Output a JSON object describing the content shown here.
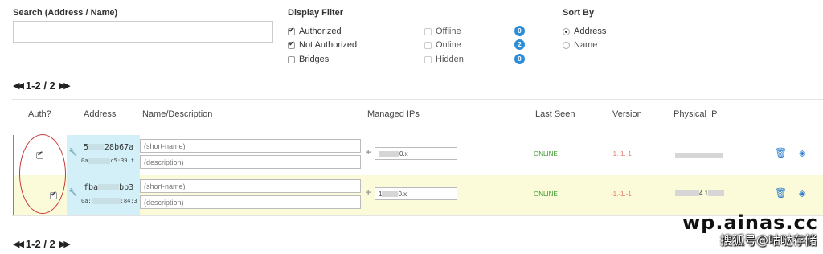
{
  "search": {
    "label": "Search (Address / Name)",
    "value": ""
  },
  "display_filter": {
    "label": "Display Filter",
    "options": [
      {
        "label": "Authorized",
        "checked": true
      },
      {
        "label": "Not Authorized",
        "checked": true
      },
      {
        "label": "Bridges",
        "checked": false
      },
      {
        "label": "Offline",
        "checked": false,
        "count": "0"
      },
      {
        "label": "Online",
        "checked": false,
        "count": "2"
      },
      {
        "label": "Hidden",
        "checked": false,
        "count": "0"
      }
    ]
  },
  "sort_by": {
    "label": "Sort By",
    "options": [
      {
        "label": "Address",
        "selected": true
      },
      {
        "label": "Name",
        "selected": false
      }
    ]
  },
  "pagination": {
    "top": "1-2 / 2",
    "bottom": "1-2 / 2"
  },
  "columns": {
    "auth": "Auth?",
    "address": "Address",
    "name": "Name/Description",
    "managed_ips": "Managed IPs",
    "last_seen": "Last Seen",
    "version": "Version",
    "physical_ip": "Physical IP"
  },
  "rows": [
    {
      "authorized": true,
      "address_prefix": "5",
      "address_suffix": "28b67a",
      "mac_prefix": "0a",
      "mac_suffix": "c5:39:f",
      "name_placeholder": "(short-name)",
      "desc_placeholder": "(description)",
      "ip_suffix": "0.x",
      "last_seen": "ONLINE",
      "version": "-1.-1.-1"
    },
    {
      "authorized": true,
      "address_prefix": "fba",
      "address_suffix": "bb3",
      "mac_prefix": "0a:",
      "mac_suffix": ":84:3",
      "name_placeholder": "(short-name)",
      "desc_placeholder": "(description)",
      "ip_prefix": "1",
      "ip_suffix": "0.x",
      "last_seen": "ONLINE",
      "version": "-1.-1.-1",
      "physical_ip_fragment": "4.1"
    }
  ],
  "watermark": {
    "line1": "wp.ainas.cc",
    "line2": "搜狐号@咕哒存储"
  },
  "colors": {
    "accent": "#2d8ed8",
    "online": "#3a9a2a",
    "version": "#e07a6a",
    "highlight_row": "#fbfbd9",
    "address_bg": "#d3f0f8"
  }
}
